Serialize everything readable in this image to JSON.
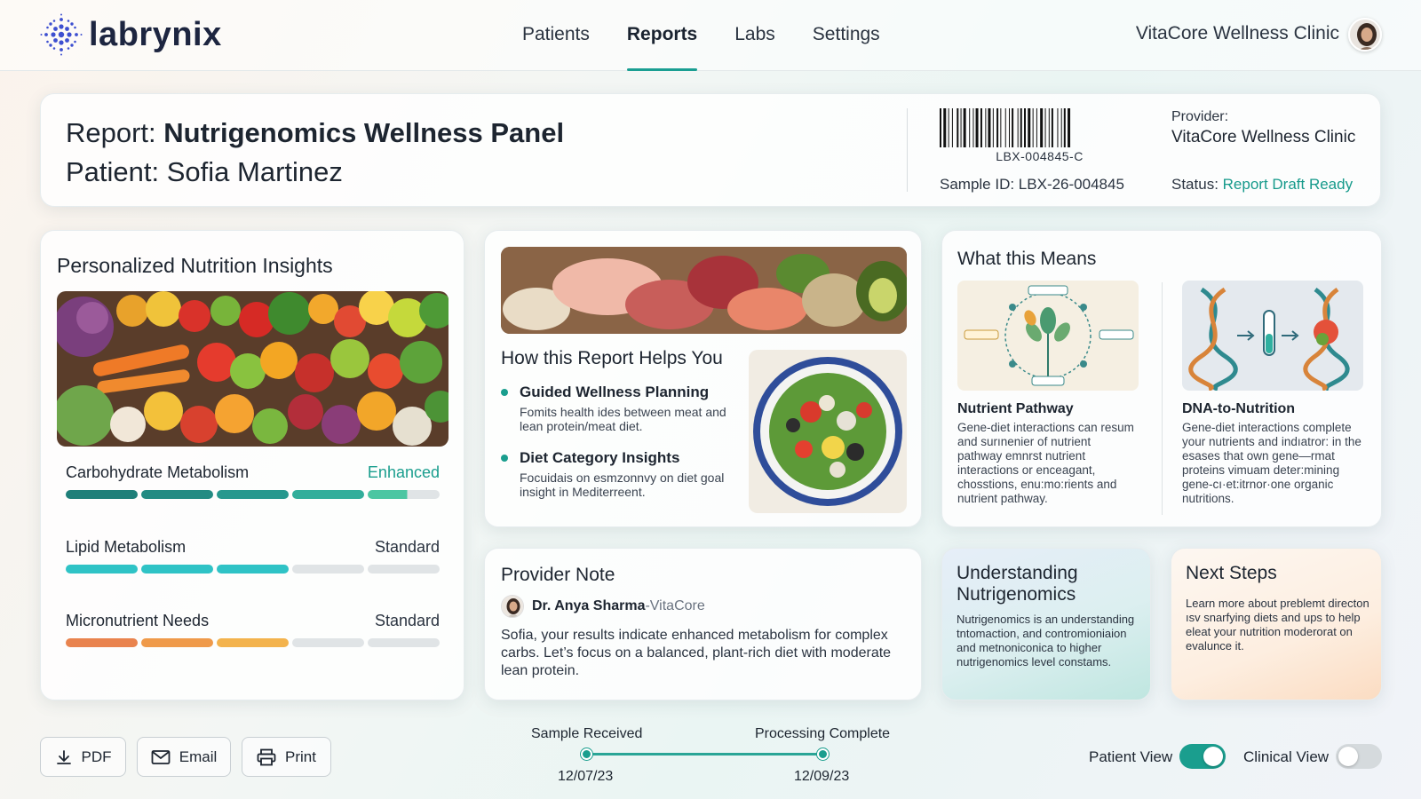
{
  "brand": {
    "name": "labrynix"
  },
  "nav": {
    "items": [
      {
        "label": "Patients",
        "active": false
      },
      {
        "label": "Reports",
        "active": true
      },
      {
        "label": "Labs",
        "active": false
      },
      {
        "label": "Settings",
        "active": false
      }
    ],
    "clinic": "VitaCore Wellness Clinic"
  },
  "header": {
    "report_prefix": "Report: ",
    "report_name": "Nutrigenomics Wellness Panel",
    "patient": "Patient: Sofia Martinez",
    "barcode_label": "LBX-004845-C",
    "sample_id": "Sample ID: LBX-26-004845",
    "provider_label": "Provider:",
    "provider_name": "VitaCore Wellness Clinic",
    "status_label": "Status: ",
    "status_value": "Report Draft Ready"
  },
  "insights": {
    "title": "Personalized Nutrition Insights",
    "metrics": [
      {
        "name": "Carbohydrate Metabolism",
        "status": "Enhanced",
        "level": 0.9
      },
      {
        "name": "Lipid Metabolism",
        "status": "Standard",
        "level": 0.6
      },
      {
        "name": "Micronutrient Needs",
        "status": "Standard",
        "level": 0.6
      }
    ]
  },
  "helps": {
    "title": "How this Report Helps You",
    "bullets": [
      {
        "title": "Guided Wellness Planning",
        "text": "Fomits health ides between meat and lean protein/meat diet."
      },
      {
        "title": "Diet Category Insights",
        "text": "Focuidais on esmzonnvy on diet goal insight in Mediterreent."
      }
    ]
  },
  "means": {
    "title": "What this Means",
    "items": [
      {
        "title": "Nutrient Pathway",
        "text": "Gene-diet interactions can resum and surınenier of nutrient pathway emnrst nutrient interactions or enceagant, chosstions, enu:mo:rients and nutrient pathway."
      },
      {
        "title": "DNA-to-Nutrition",
        "text": "Gene-diet interactions complete your nutrients and indıatror: in the esases that own gene—rmat proteins vimuam deter:mining gene-cı·et:itrnor·one organic nutritions."
      }
    ]
  },
  "note": {
    "title": "Provider Note",
    "author": "Dr. Anya Sharma",
    "separator": " - ",
    "org": "VitaCore",
    "text": "Sofia, your results indicate enhanced metabolism for complex carbs. Let’s focus on a balanced, plant-rich diet with moderate lean protein."
  },
  "understanding": {
    "title": "Understanding Nutrigenomics",
    "text": "Nutrigenomics is an understanding tntomaction, and contromioniaion and metnoniconica to higher nutrigenomics level constams."
  },
  "next_steps": {
    "title": "Next Steps",
    "text": "Learn more about preblemt directon ısv snarfying diets and ups to help eleat your nutrition moderorat on evalunce it."
  },
  "actions": {
    "pdf": "PDF",
    "email": "Email",
    "print": "Print"
  },
  "timeline": {
    "steps": [
      {
        "label": "Sample Received",
        "date": "12/07/23"
      },
      {
        "label": "Processing Complete",
        "date": "12/09/23"
      }
    ]
  },
  "views": {
    "patient": {
      "label": "Patient View",
      "on": true
    },
    "clinical": {
      "label": "Clinical View",
      "on": false
    }
  },
  "colors": {
    "accent": "#1a9e8e",
    "carb_bar": [
      "#1f7f79",
      "#238b83",
      "#27988e",
      "#32ae9b",
      "#4cc6a2"
    ],
    "lipid_bar": "#2fc3c6",
    "micro_bar": [
      "#e9834e",
      "#ef9a4a",
      "#f3b34d"
    ]
  }
}
